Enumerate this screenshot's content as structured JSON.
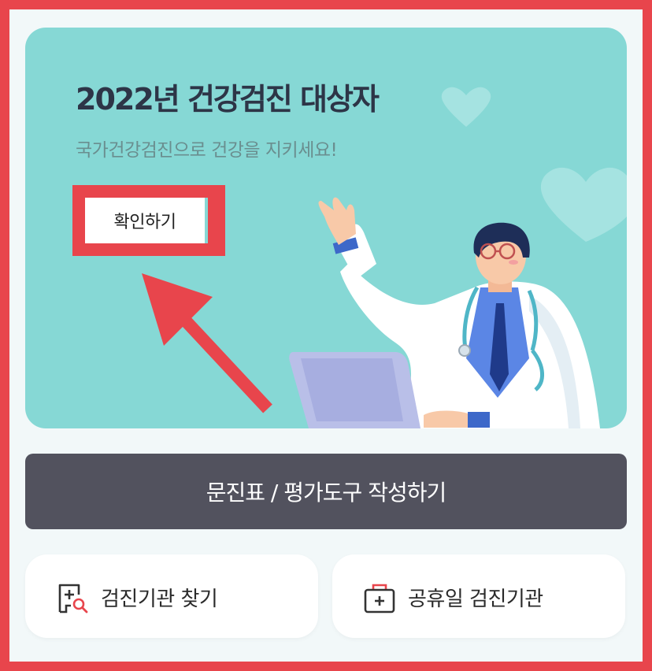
{
  "banner": {
    "title": "2022년 건강검진 대상자",
    "subtitle": "국가건강검진으로 건강을 지키세요!",
    "confirm_label": "확인하기"
  },
  "survey_button": {
    "label": "문진표 / 평가도구 작성하기"
  },
  "cards": [
    {
      "label": "검진기관 찾기",
      "icon": "hospital-search-icon"
    },
    {
      "label": "공휴일 검진기관",
      "icon": "medical-kit-icon"
    }
  ],
  "colors": {
    "banner_bg": "#86d8d5",
    "highlight_red": "#e8454c",
    "survey_bg": "#52525e",
    "page_bg": "#f2f8f9"
  }
}
